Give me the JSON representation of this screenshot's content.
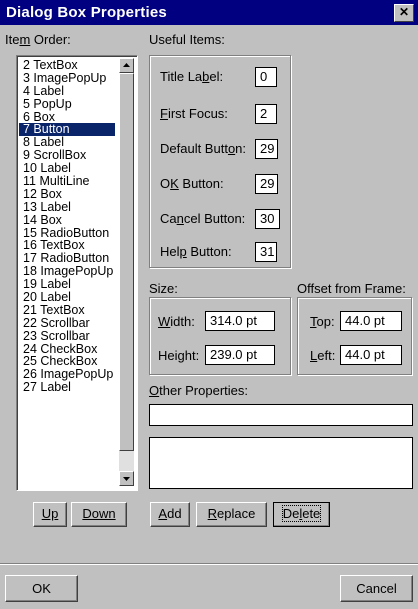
{
  "window": {
    "title": "Dialog Box Properties",
    "close_glyph": "✕"
  },
  "item_order": {
    "label_pre": "Ite",
    "label_ul": "m",
    "label_post": " Order:",
    "items": [
      "2 TextBox",
      "3 ImagePopUp",
      "4 Label",
      "5 PopUp",
      "6 Box",
      "7 Button",
      "8 Label",
      "9 ScrollBox",
      "10 Label",
      "11 MultiLine",
      "12 Box",
      "13 Label",
      "14 Box",
      "15 RadioButton",
      "16 TextBox",
      "17 RadioButton",
      "18 ImagePopUp",
      "19 Label",
      "20 Label",
      "21 TextBox",
      "22 Scrollbar",
      "23 Scrollbar",
      "24 CheckBox",
      "25 CheckBox",
      "26 ImagePopUp",
      "27 Label"
    ],
    "selected_index": 5,
    "up_label": "Up",
    "down_label": "Down"
  },
  "useful_items": {
    "heading": "Useful Items:",
    "title_label": {
      "pre": "Title La",
      "ul": "b",
      "post": "el:",
      "value": "0"
    },
    "first_focus": {
      "pre": "",
      "ul": "F",
      "post": "irst Focus:",
      "value": "2"
    },
    "default_button": {
      "pre": "Default Butt",
      "ul": "o",
      "post": "n:",
      "value": "29"
    },
    "ok_button": {
      "pre": "O",
      "ul": "K",
      "post": " Button:",
      "value": "29"
    },
    "cancel_button": {
      "pre": "Ca",
      "ul": "n",
      "post": "cel Button:",
      "value": "30"
    },
    "help_button": {
      "pre": "Hel",
      "ul": "p",
      "post": " Button:",
      "value": "31"
    }
  },
  "size": {
    "heading": "Size:",
    "width": {
      "pre": "",
      "ul": "W",
      "post": "idth:",
      "value": "314.0 pt"
    },
    "height": {
      "pre": "Height:",
      "ul": "",
      "post": "",
      "value": "239.0 pt"
    }
  },
  "offset": {
    "heading": "Offset from Frame:",
    "top": {
      "pre": "",
      "ul": "T",
      "post": "op:",
      "value": "44.0 pt"
    },
    "left": {
      "pre": "",
      "ul": "L",
      "post": "eft:",
      "value": "44.0 pt"
    }
  },
  "other_properties": {
    "heading_pre": "",
    "heading_ul": "O",
    "heading_post": "ther Properties:",
    "input_value": "",
    "text_value": ""
  },
  "actions": {
    "add": {
      "ul": "A",
      "rest": "dd"
    },
    "replace": {
      "ul": "R",
      "rest": "eplace"
    },
    "delete": {
      "pre": "De",
      "ul": "l",
      "rest": "ete"
    }
  },
  "footer": {
    "ok_label": "OK",
    "cancel_label": "Cancel"
  }
}
